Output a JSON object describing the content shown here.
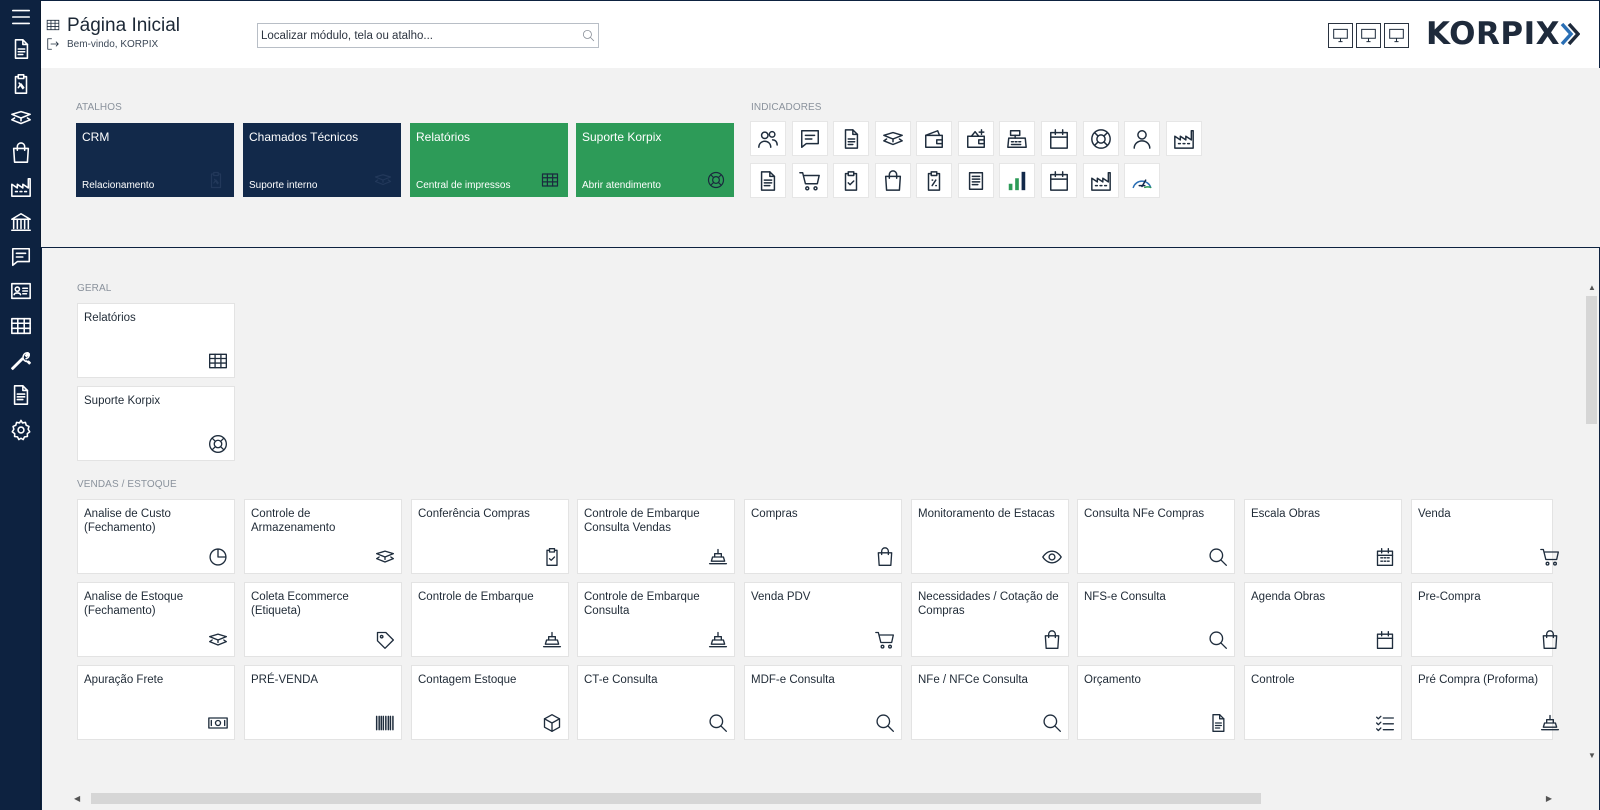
{
  "sidebar": {
    "menu_icon": "hamburger-icon",
    "items": [
      {
        "name": "document",
        "icon": "document-icon"
      },
      {
        "name": "clipboard",
        "icon": "clipboard-icon"
      },
      {
        "name": "layers",
        "icon": "layers-icon"
      },
      {
        "name": "shopping-bag",
        "icon": "bag-icon"
      },
      {
        "name": "factory",
        "icon": "factory-icon"
      },
      {
        "name": "bank",
        "icon": "bank-icon"
      },
      {
        "name": "chat",
        "icon": "chat-icon"
      },
      {
        "name": "contact-card",
        "icon": "id-card-icon"
      },
      {
        "name": "table",
        "icon": "table-icon"
      },
      {
        "name": "tools",
        "icon": "wrench-icon"
      },
      {
        "name": "report",
        "icon": "report-icon"
      },
      {
        "name": "settings",
        "icon": "gear-icon"
      }
    ]
  },
  "header": {
    "title": "Página Inicial",
    "subtitle": "Bem-vindo, KORPIX",
    "search_placeholder": "Localizar módulo, tela ou atalho...",
    "logo_text": "KORPIX",
    "brand_color": "#1e2a3b",
    "logo_accent": "#2a6fb5"
  },
  "atalhos": {
    "label": "ATALHOS",
    "tiles": [
      {
        "title": "CRM",
        "subtitle": "Relacionamento",
        "style": "dark",
        "icon": "clipboard-icon"
      },
      {
        "title": "Chamados Técnicos",
        "subtitle": "Suporte interno",
        "style": "dark",
        "icon": "layers-icon"
      },
      {
        "title": "Relatórios",
        "subtitle": "Central de impressos",
        "style": "green",
        "icon": "table-icon"
      },
      {
        "title": "Suporte Korpix",
        "subtitle": "Abrir atendimento",
        "style": "green",
        "icon": "lifebuoy-icon"
      }
    ],
    "colors": {
      "dark": "#12294a",
      "green": "#2d9b58"
    }
  },
  "indicadores": {
    "label": "INDICADORES",
    "row1": [
      "people-icon",
      "chat-icon",
      "document-icon",
      "layers-icon",
      "wallet-icon",
      "wallet-plus-icon",
      "cash-register-icon",
      "calendar-icon",
      "lifebuoy-icon",
      "user-icon",
      "factory-icon"
    ],
    "row2": [
      "report-icon",
      "cart-icon",
      "clipboard-check-icon",
      "bag-icon",
      "receipt-icon",
      "document-lines-icon",
      "bar-chart-icon",
      "calendar-icon",
      "factory-icon",
      "gauge-icon"
    ]
  },
  "geral": {
    "label": "GERAL",
    "cards": [
      {
        "title": "Relatórios",
        "icon": "table-icon"
      },
      {
        "title": "Suporte Korpix",
        "icon": "lifebuoy-icon"
      }
    ]
  },
  "vendas": {
    "label": "VENDAS / ESTOQUE",
    "rows": [
      [
        {
          "title": "Analise de Custo (Fechamento)",
          "icon": "pie-chart-icon"
        },
        {
          "title": "Controle de Armazenamento",
          "icon": "layers-icon"
        },
        {
          "title": "Conferência Compras",
          "icon": "clipboard-check-icon"
        },
        {
          "title": "Controle de Embarque Consulta Vendas",
          "icon": "ship-icon"
        },
        {
          "title": "Compras",
          "icon": "bag-icon"
        },
        {
          "title": "Monitoramento de Estacas",
          "icon": "eye-icon"
        },
        {
          "title": "Consulta NFe Compras",
          "icon": "search-icon"
        },
        {
          "title": "Escala Obras",
          "icon": "calendar-grid-icon"
        },
        {
          "title": "Venda",
          "icon": "cart-icon"
        }
      ],
      [
        {
          "title": "Analise de Estoque (Fechamento)",
          "icon": "layers-icon"
        },
        {
          "title": "Coleta Ecommerce (Etiqueta)",
          "icon": "tag-icon"
        },
        {
          "title": "Controle de Embarque",
          "icon": "ship-icon"
        },
        {
          "title": "Controle de Embarque Consulta",
          "icon": "ship-icon"
        },
        {
          "title": "Venda PDV",
          "icon": "cart-icon"
        },
        {
          "title": "Necessidades / Cotação de Compras",
          "icon": "bag-icon"
        },
        {
          "title": "NFS-e Consulta",
          "icon": "search-icon"
        },
        {
          "title": "Agenda Obras",
          "icon": "calendar-icon"
        },
        {
          "title": "Pre-Compra",
          "icon": "bag-icon"
        }
      ],
      [
        {
          "title": "Apuração Frete",
          "icon": "money-icon"
        },
        {
          "title": "PRÉ-VENDA",
          "icon": "barcode-icon"
        },
        {
          "title": "Contagem Estoque",
          "icon": "box-icon"
        },
        {
          "title": "CT-e Consulta",
          "icon": "search-icon"
        },
        {
          "title": "MDF-e Consulta",
          "icon": "search-icon"
        },
        {
          "title": "NFe / NFCe Consulta",
          "icon": "search-icon"
        },
        {
          "title": "Orçamento",
          "icon": "document-icon"
        },
        {
          "title": "Controle",
          "icon": "checklist-icon"
        },
        {
          "title": "Pré Compra (Proforma)",
          "icon": "ship-icon"
        }
      ]
    ]
  }
}
